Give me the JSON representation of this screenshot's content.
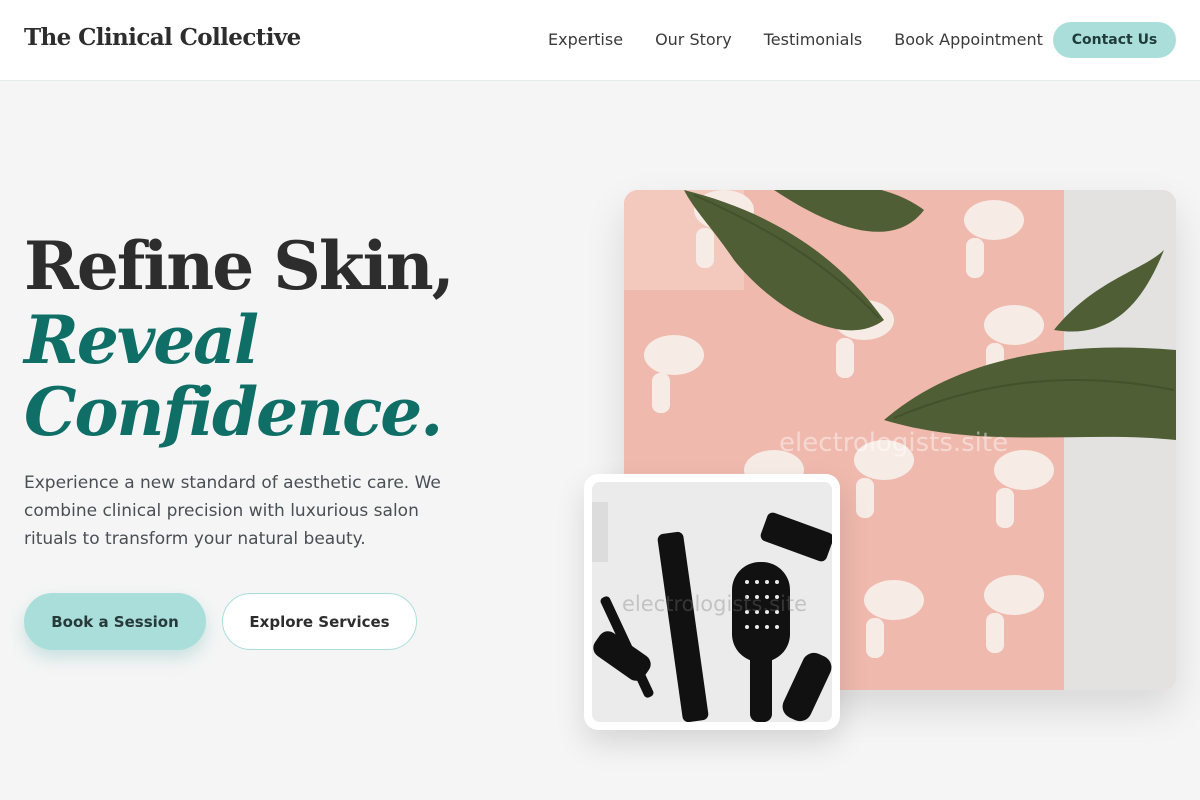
{
  "header": {
    "logo": "The Clinical Collective",
    "nav": [
      "Expertise",
      "Our Story",
      "Testimonials",
      "Book Appointment"
    ],
    "contact_label": "Contact Us"
  },
  "hero": {
    "title_line1": "Refine Skin,",
    "title_line2": "Reveal",
    "title_line3": "Confidence.",
    "description": "Experience a new standard of aesthetic care. We combine clinical precision with luxurious salon rituals to transform your natural beauty.",
    "primary_button": "Book a Session",
    "secondary_button": "Explore Services"
  },
  "images": {
    "main_watermark": "electrologists.site",
    "thumb_watermark": "electrologists.site"
  },
  "colors": {
    "accent": "#a9dedb",
    "accent_dark": "#0f6f67",
    "background": "#f5f5f5",
    "text": "#2d2d2d",
    "main_image_bg": "#efb9ad"
  }
}
